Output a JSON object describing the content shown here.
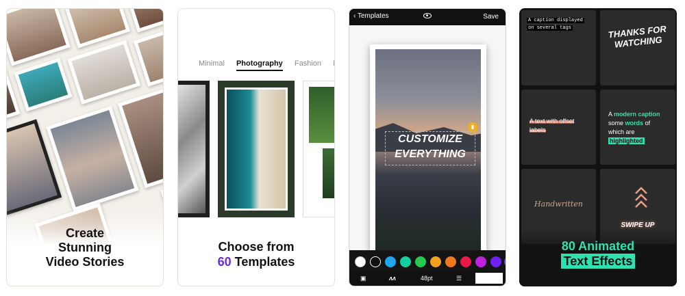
{
  "panel1": {
    "title_line1": "Create",
    "title_line2": "Stunning",
    "title_line3": "Video Stories"
  },
  "panel2": {
    "tabs": [
      "Minimal",
      "Photography",
      "Fashion",
      "Ne"
    ],
    "active_tab": "Photography",
    "title_line1": "Choose from",
    "title_number": "60",
    "title_rest": "Templates",
    "accent": "#6a2ce0"
  },
  "panel3": {
    "back_label": "Templates",
    "save_label": "Save",
    "preview_text_line1": "CUSTOMIZE",
    "preview_text_line2": "EVERYTHING",
    "font_size": "48pt",
    "colors": [
      "#ffffff",
      "#111111",
      "#1ea7f0",
      "#14d0a0",
      "#28c850",
      "#f4a020",
      "#f07820",
      "#e81848",
      "#c020e0",
      "#7020f0",
      "#6040ff"
    ]
  },
  "panel4": {
    "cap1_line1": "A caption displayed",
    "cap1_line2": "on several tags",
    "thanks_line1": "THANKS FOR",
    "thanks_line2": "WATCHING",
    "offset_line1": "A text with offset",
    "offset_line2": "labels",
    "modern": {
      "a": "A",
      "b": "modern caption",
      "c": "some",
      "d": "words",
      "e": "of",
      "f": "which are",
      "g": "highlighted"
    },
    "handwritten": "Handwritten",
    "swipe": "SWIPE UP",
    "title_line1": "80 Animated",
    "title_line2": "Text Effects",
    "accent": "#2fe0b0"
  }
}
